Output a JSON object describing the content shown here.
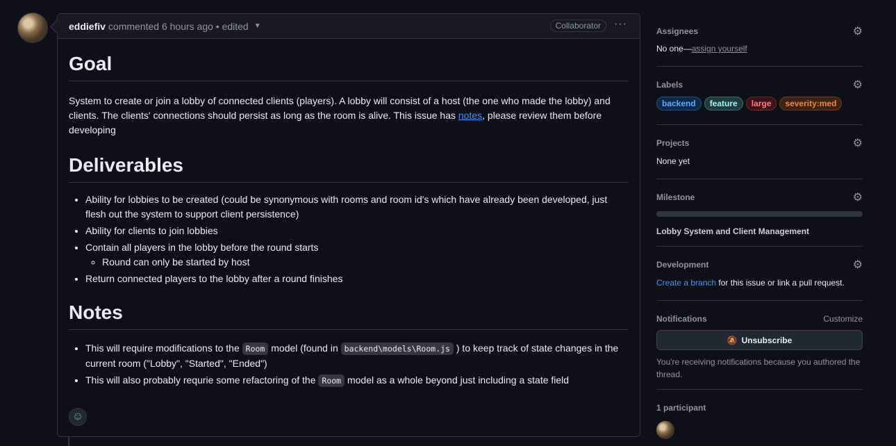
{
  "comment": {
    "author": "eddiefiv",
    "meta": "commented 6 hours ago • edited",
    "badge": "Collaborator",
    "menu": "···",
    "goal_heading": "Goal",
    "goal_text_before": "System to create or join a lobby of connected clients (players). A lobby will consist of a host (the one who made the lobby) and clients. The clients' connections should persist as long as the room is alive. This issue has ",
    "goal_link": "notes",
    "goal_text_after": ", please review them before developing",
    "deliverables_heading": "Deliverables",
    "deliverables": [
      "Ability for lobbies to be created (could be synonymous with rooms and room id's which have already been developed, just flesh out the system to support client persistence)",
      "Ability for clients to join lobbies",
      "Contain all players in the lobby before the round starts",
      "Round can only be started by host",
      "Return connected players to the lobby after a round finishes"
    ],
    "notes_heading": "Notes",
    "note1_a": "This will require modifications to the ",
    "note1_code1": "Room",
    "note1_b": " model (found in ",
    "note1_code2": "backend\\models\\Room.js",
    "note1_c": " ) to keep track of state changes in the current room (\"Lobby\", \"Started\", \"Ended\")",
    "note2_a": "This will also probably requrie some refactoring of the ",
    "note2_code": "Room",
    "note2_b": " model as a whole beyond just including a state field"
  },
  "sidebar": {
    "assignees_title": "Assignees",
    "assignees_value": "No one—",
    "assign_link": "assign yourself",
    "labels_title": "Labels",
    "labels": [
      {
        "name": "backend",
        "color": "#58a6ff",
        "bg": "#0d2a4a",
        "border": "#1f4f80"
      },
      {
        "name": "feature",
        "color": "#a5f3f0",
        "bg": "#1f3b3e",
        "border": "#3b6e71"
      },
      {
        "name": "large",
        "color": "#ff7b8a",
        "bg": "#3a1419",
        "border": "#6e2630"
      },
      {
        "name": "severity:med",
        "color": "#f0883e",
        "bg": "#3d2314",
        "border": "#6b3c1d"
      }
    ],
    "projects_title": "Projects",
    "projects_value": "None yet",
    "milestone_title": "Milestone",
    "milestone_progress": 0,
    "milestone_value": "Lobby System and Client Management",
    "development_title": "Development",
    "dev_link": "Create a branch",
    "dev_text": " for this issue or link a pull request.",
    "notifications_title": "Notifications",
    "customize": "Customize",
    "unsubscribe": "Unsubscribe",
    "notif_text": "You're receiving notifications because you authored the thread.",
    "participants_title": "1 participant"
  }
}
